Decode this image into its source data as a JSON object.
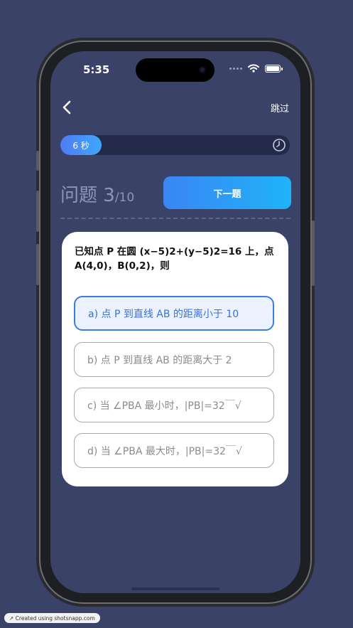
{
  "status_bar": {
    "time": "5:35"
  },
  "header": {
    "back_icon": "chevron-left-icon",
    "skip_label": "跳过"
  },
  "timer": {
    "label": "6 秒",
    "progress": 0.18,
    "icon": "clock-icon"
  },
  "question_header": {
    "prefix": "问题 ",
    "current": "3",
    "total": "/10",
    "next_label": "下一题"
  },
  "question": {
    "line1": "已知点 P 在圆 (x−5)2+(y−5)2=16 上，点",
    "line2": "A(4,0)，B(0,2)，则"
  },
  "options": [
    {
      "label": "a) 点 P 到直线 AB 的距离小于 10",
      "selected": true
    },
    {
      "label": "b) 点 P 到直线 AB 的距离大于 2",
      "selected": false
    },
    {
      "label": "c) 当 ∠PBA 最小时，|PB|=32￣√",
      "selected": false
    },
    {
      "label": "d) 当 ∠PBA 最大时，|PB|=32￣√",
      "selected": false
    }
  ],
  "colors": {
    "background": "#3b4268",
    "accent": "#3a86f4",
    "selected_border": "#3a7ee4"
  },
  "watermark": {
    "label": "Created using shotsnapp.com"
  }
}
